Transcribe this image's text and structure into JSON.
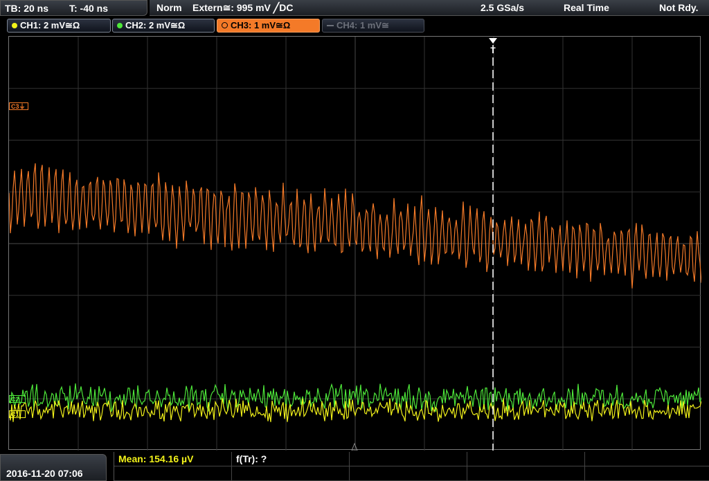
{
  "top": {
    "timebase": "TB: 20 ns",
    "trigger_pos": "T: -40 ns",
    "mode": "Norm",
    "trigger_source": "Extern≅: 995 mV ╱DC",
    "sample_rate": "2.5 GSa/s",
    "acq_mode": "Real Time",
    "status": "Not Rdy."
  },
  "channels": [
    {
      "label": "CH1: 2 mV≅Ω",
      "color": "#f2f21a",
      "state": "on"
    },
    {
      "label": "CH2: 2 mV≅Ω",
      "color": "#4ee83a",
      "state": "on"
    },
    {
      "label": "CH3: 1 mV≅Ω",
      "color": "#f47a28",
      "state": "active"
    },
    {
      "label": "CH4: 1 mV≅",
      "color": "#6c707a",
      "state": "off"
    }
  ],
  "markers": {
    "ch3_label": "C3",
    "ch2_label": "C2",
    "ch1_label": "C1",
    "trigger_label": "T"
  },
  "measurement": {
    "mean": "Mean: 154.16 µV",
    "freq": "f(Tr): ?"
  },
  "datetime": "2016-11-20 07:06",
  "colors": {
    "ch1": "#f2f21a",
    "ch2": "#4ee83a",
    "ch3": "#f47a28",
    "grid": "#3c3c3c",
    "trigger": "#ffffff"
  }
}
